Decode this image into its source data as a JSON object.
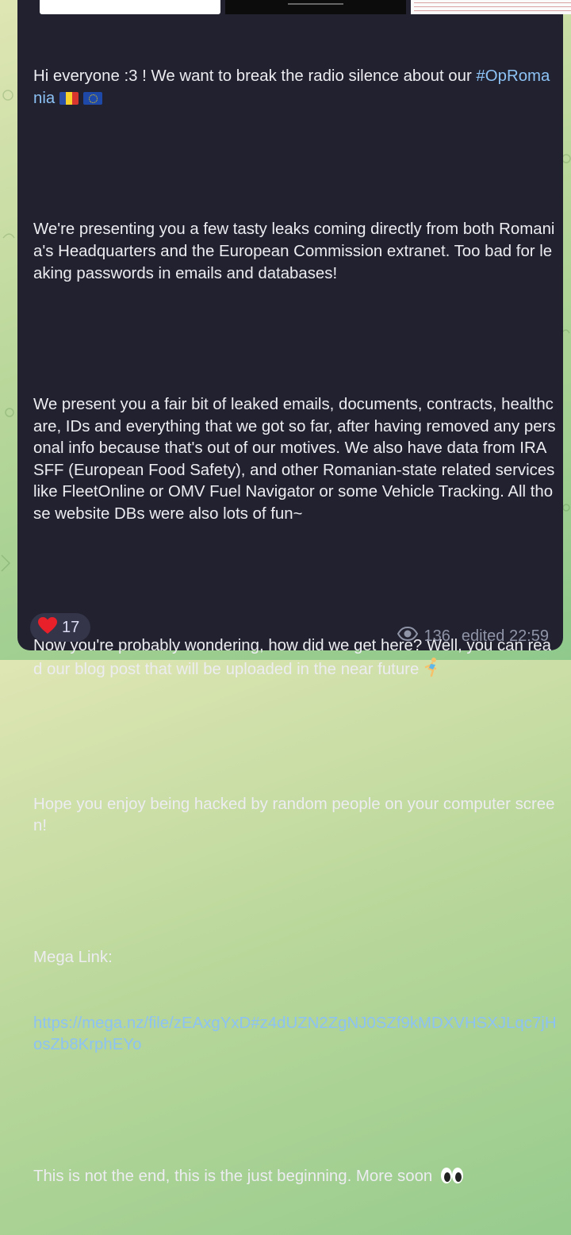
{
  "message": {
    "intro": "Hi everyone :3 ! We want to break the radio silence about our",
    "hashtag": "#OpRomania",
    "p2": "We're presenting you a few tasty leaks coming directly from both Romania's Headquarters and the European Commission extranet. Too bad for leaking passwords in emails and databases!",
    "p3": "We present you a fair bit of leaked emails, documents, contracts, healthcare, IDs and everything that we got so far, after having removed any personal info because that's out of our motives. We also have data from IRASFF (European Food Safety), and other Romanian-state related services like FleetOnline or OMV Fuel Navigator or some Vehicle Tracking. All those website DBs were also lots of fun~",
    "p4": "Now you're probably wondering, how did we get here? Well, you can read our blog post that will be uploaded in the near future",
    "p5": "Hope you enjoy being hacked by random people on your computer screen!",
    "mega_label": "Mega Link:",
    "mega_url": "https://mega.nz/file/zEAxgYxD#z4dUZN2ZgNJ0SZf9kMDXVHSXJLqc7jHosZb8KrphEYo",
    "p7": "This is not the end, this is the just beginning. More soon"
  },
  "reaction": {
    "count": "17",
    "icon": "heart-icon",
    "color": "#e8202a"
  },
  "meta": {
    "views": "136",
    "status": "edited 22:59"
  },
  "colors": {
    "bubble": "#212130",
    "text": "#ececf1",
    "link": "#8cc2f4",
    "meta": "#8f94a6"
  }
}
